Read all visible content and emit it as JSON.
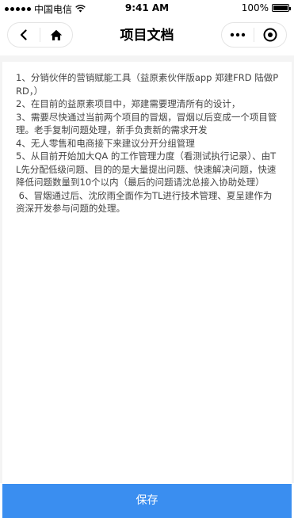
{
  "status_bar": {
    "carrier": "中国电信",
    "time": "9:41 AM",
    "battery": "100%"
  },
  "nav": {
    "title": "项目文档",
    "back_icon": "chevron-left-icon",
    "home_icon": "home-icon",
    "more_icon": "more-dots-icon",
    "close_icon": "target-circle-icon"
  },
  "document": {
    "paragraphs": [
      "1、分销伙伴的营销赋能工具（益原素伙伴版app 郑建FRD 陆做PRD，）",
      "2、在目前的益原素项目中，郑建需要理清所有的设计，",
      "3、需要尽快通过当前两个项目的冒烟，冒烟以后变成一个项目管理。老手复制问题处理，新手负责新的需求开发",
      "4、无人零售和电商接下来建议分开分组管理",
      "5、从目前开始加大QA 的工作管理力度（看测试执行记录）、由TL先分配低级问题、目的的是大量提出问题、快速解决问题，快速降低问题数量到10个以内（最后的问题请沈总接入协助处理）",
      " 6、冒烟通过后、沈欣雨全面作为TL进行技术管理、夏呈建作为资深开发参与问题的处理。"
    ]
  },
  "footer": {
    "save_label": "保存"
  },
  "colors": {
    "accent": "#3a8ef0",
    "background": "#f4f4f4"
  }
}
